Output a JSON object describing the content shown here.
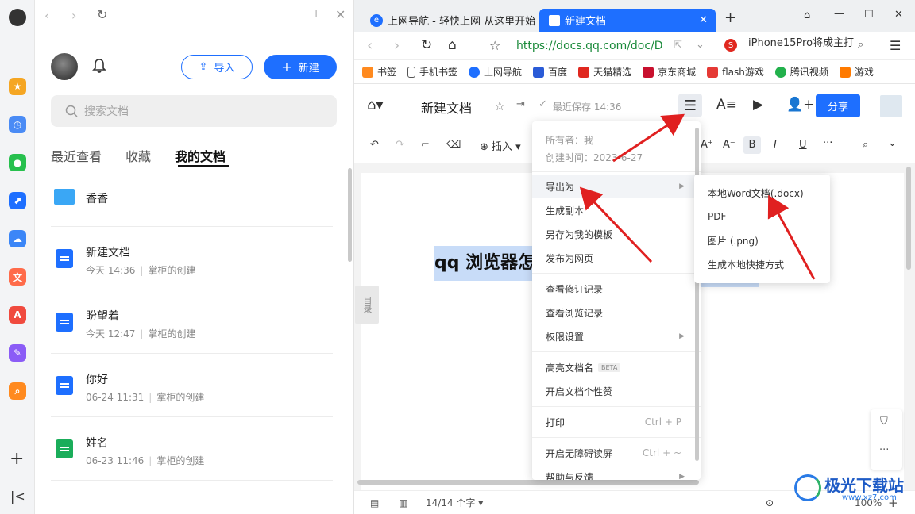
{
  "sidebar": {
    "import_label": "导入",
    "new_label": "新建",
    "search_placeholder": "搜索文档",
    "tabs": [
      {
        "label": "最近查看"
      },
      {
        "label": "收藏"
      },
      {
        "label": "我的文档"
      }
    ],
    "folder": {
      "name": "香香"
    },
    "docs": [
      {
        "title": "新建文档",
        "time": "今天 14:36",
        "creator": "掌柜的创建",
        "color": "#1e6fff"
      },
      {
        "title": "盼望着",
        "time": "今天 12:47",
        "creator": "掌柜的创建",
        "color": "#1e6fff"
      },
      {
        "title": "你好",
        "time": "06-24 11:31",
        "creator": "掌柜的创建",
        "color": "#1e6fff"
      },
      {
        "title": "姓名",
        "time": "06-23 11:46",
        "creator": "掌柜的创建",
        "color": "#1aad5a"
      }
    ]
  },
  "browser": {
    "tabs": [
      {
        "label": "上网导航 - 轻快上网 从这里开始"
      },
      {
        "label": "新建文档"
      }
    ],
    "url": "https://docs.qq.com/doc/D",
    "search_hint": "iPhone15Pro将成主打",
    "bookmarks": [
      "书签",
      "手机书签",
      "上网导航",
      "百度",
      "天猫精选",
      "京东商城",
      "flash游戏",
      "腾讯视频",
      "游戏"
    ]
  },
  "doc": {
    "title": "新建文档",
    "saved": "最近保存 14:36",
    "share_label": "分享",
    "insert_label": "插入",
    "content": "qq 浏览器怎",
    "outline_label": "目录",
    "word_count": "14/14 个字",
    "zoom": "100%"
  },
  "menu": {
    "owner": "所有者：我",
    "created": "创建时间：2023-6-27",
    "items": [
      {
        "label": "导出为",
        "submenu": true
      },
      {
        "label": "生成副本"
      },
      {
        "label": "另存为我的模板"
      },
      {
        "label": "发布为网页"
      },
      {
        "label": "查看修订记录"
      },
      {
        "label": "查看浏览记录"
      },
      {
        "label": "权限设置",
        "submenu": true
      },
      {
        "label": "高亮文档名",
        "badge": "BETA"
      },
      {
        "label": "开启文档个性赞"
      },
      {
        "label": "打印",
        "shortcut": "Ctrl + P"
      },
      {
        "label": "开启无障碍读屏",
        "shortcut": "Ctrl + ~"
      },
      {
        "label": "帮助与反馈",
        "submenu": true
      }
    ]
  },
  "submenu": {
    "items": [
      {
        "label": "本地Word文档(.docx)"
      },
      {
        "label": "PDF"
      },
      {
        "label": "图片 (.png)"
      },
      {
        "label": "生成本地快捷方式"
      }
    ]
  },
  "watermark": {
    "text": "极光下载站",
    "url": "www.xz7.com"
  },
  "colors": {
    "accent": "#1e6fff",
    "annotation": "#e02020",
    "selection": "#c8dcf8"
  }
}
